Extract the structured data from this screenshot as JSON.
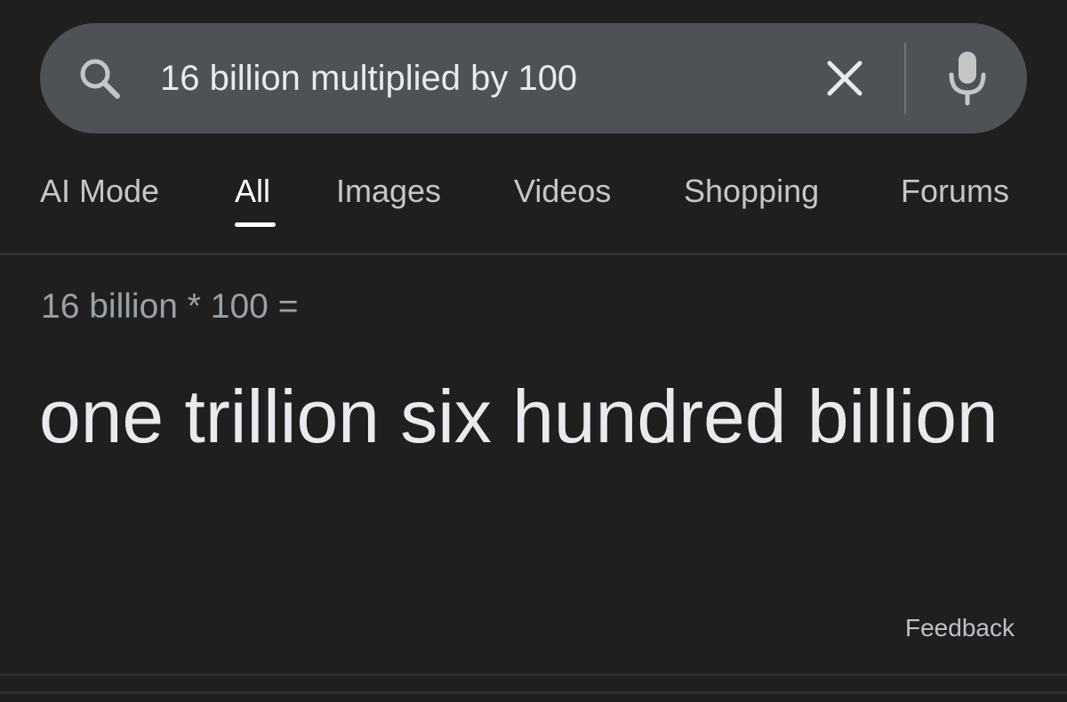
{
  "search": {
    "query": "16 billion multiplied by 100"
  },
  "tabs": [
    {
      "label": "AI Mode",
      "active": false
    },
    {
      "label": "All",
      "active": true
    },
    {
      "label": "Images",
      "active": false
    },
    {
      "label": "Videos",
      "active": false
    },
    {
      "label": "Shopping",
      "active": false
    },
    {
      "label": "Forums",
      "active": false
    }
  ],
  "calculator": {
    "expression": "16 billion * 100 =",
    "result": "one trillion six hundred billion"
  },
  "feedback_label": "Feedback",
  "icons": {
    "search": "search-icon",
    "clear": "close-icon",
    "mic": "microphone-icon"
  },
  "colors": {
    "background": "#1f1f1f",
    "search_bar": "#4e5257",
    "text_primary": "#e8eaed",
    "text_secondary": "#9aa0a6",
    "active_tab": "#ffffff"
  }
}
